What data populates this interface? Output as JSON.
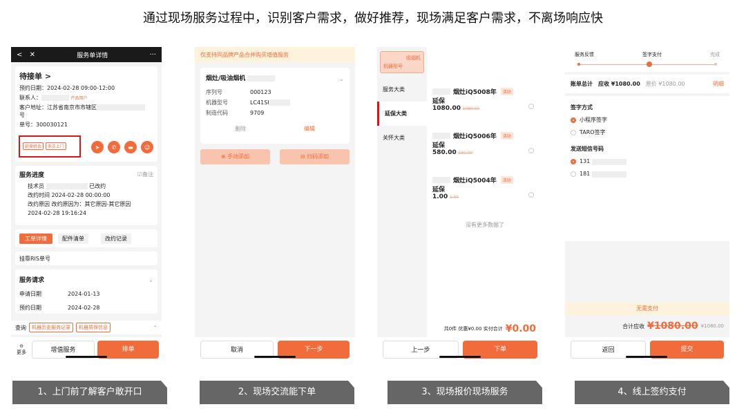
{
  "headline": "通过现场服务过程中，识别客户需求，做好推荐，现场满足客户需求，不离场响应快",
  "captions": [
    "1、上门前了解客户敢开口",
    "2、现场交流能下单",
    "3、现场报价现场服务",
    "4、线上签约支付"
  ],
  "p1": {
    "back": "<",
    "close": "✕",
    "title": "服务单详情",
    "more": "···",
    "order_status": "待接单 >",
    "appt": "预约日期：2024-02-28  09:00-12:00",
    "contact": "联系人：",
    "contact_tag": "产品用户",
    "address": "客户地址：江苏省南京市市辖区",
    "address2": "号",
    "order_no": "单号：300030121",
    "chance_tags": [
      "延保机会",
      "多次上门"
    ],
    "progress_title": "服务进度",
    "remark": "☑备注",
    "tech": "技术员",
    "tech_status": "已改约",
    "change_time": "改约时间 2024-02-28 00:00:00",
    "change_reason": "改约原因 改约原因为：其它原因-其它原因",
    "record_time": "2024-02-28 19:16:24",
    "tabs": [
      "工单详情",
      "配件清单",
      "改约记录"
    ],
    "ris": "挂靠RIS单号",
    "req_title": "服务请求",
    "apply_label": "申请日期",
    "apply_date": "2024-01-13",
    "appt_label": "预约日期",
    "appt_date": "2024-02-28",
    "query": "查询",
    "query_btns": [
      "机器历史服务记录",
      "机器质保信息"
    ],
    "more_label": "更多",
    "value_add": "增值服务",
    "dispatch": "排单"
  },
  "p2": {
    "notice": "仅支持同品牌产品合并购买增值服务",
    "product": "烟灶/吸油烟机",
    "fields": [
      {
        "label": "序列号",
        "value": "000123"
      },
      {
        "label": "机器型号",
        "value": "LC41SI"
      },
      {
        "label": "制造代码",
        "value": "9709"
      }
    ],
    "delete": "删除",
    "edit": "编辑",
    "manual_add": "⊕ 手动添加",
    "scan_add": "⊟ 扫码添加",
    "cancel": "取消",
    "next": "下一步"
  },
  "p3": {
    "top_tag": "吸烟机",
    "top_tag2": "机器型号",
    "menu": [
      "服务大类",
      "延保大类",
      "关怀大类"
    ],
    "items": [
      {
        "name": "烟灶iQ5008年",
        "line2": "延保",
        "price": "1080.00",
        "old": "1080.00",
        "tag": "活动"
      },
      {
        "name": "烟灶iQ5006年",
        "line2": "延保",
        "price": "580.00",
        "old": "580.00",
        "tag": "活动"
      },
      {
        "name": "烟灶iQ5004年",
        "line2": "延保",
        "price": "1.00",
        "old": "1.00",
        "tag": "活动"
      }
    ],
    "no_more": "没有更多数据了",
    "summary": "共0件  优惠¥0.00 实付合计",
    "total": "¥0.00",
    "prev": "上一步",
    "submit": "下单"
  },
  "p4": {
    "steps": [
      "服务反馈",
      "签字支付",
      "完成"
    ],
    "total_label": "账单总计",
    "due": "应收 ¥1080.00",
    "orig": "原价 ¥1080.00",
    "detail": "明细",
    "sign_title": "签字方式",
    "sign_opts": [
      "小程序签字",
      "TARO签字"
    ],
    "sms_title": "发送短信号码",
    "sms_opts": [
      "131",
      "181"
    ],
    "no_pay": "无需支付",
    "sum_label": "合计应收",
    "sum_strike": "¥1080.00",
    "sum_small": "¥1080.00",
    "back": "返回",
    "submit": "提交"
  }
}
